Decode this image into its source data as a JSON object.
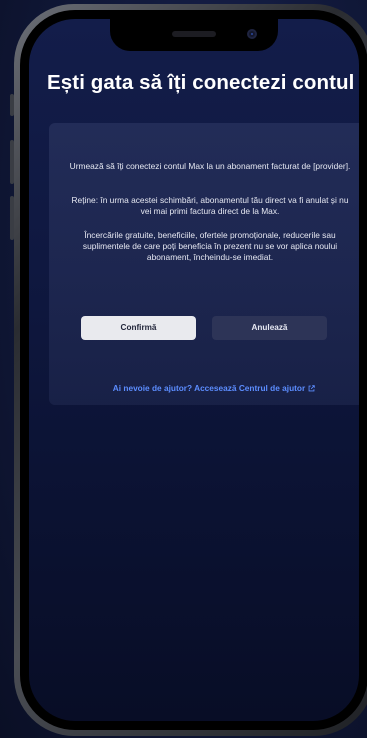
{
  "screen": {
    "title": "Ești gata să îți conectezi contul"
  },
  "card": {
    "paragraph_1": "Urmează să îți conectezi contul Max la un abonament facturat de [provider].",
    "paragraph_2": "Reține: în urma acestei schimbări, abonamentul tău direct va fi anulat și nu vei mai primi factura direct de la Max.",
    "paragraph_3": "Încercările gratuite, beneficiile, ofertele promoționale, reducerile sau suplimentele de care poți beneficia în prezent nu se vor aplica noului abonament, încheindu-se imediat."
  },
  "buttons": {
    "confirm_label": "Confirmă",
    "cancel_label": "Anulează"
  },
  "help": {
    "link_text": "Ai nevoie de ajutor? Accesează Centrul de ajutor",
    "icon": "external-link-icon"
  },
  "colors": {
    "link": "#5c8dff",
    "confirm_bg": "#e9eaee",
    "cancel_bg": "#2d3457"
  }
}
